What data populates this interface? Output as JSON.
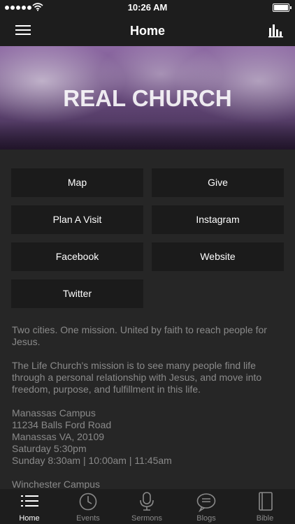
{
  "status_bar": {
    "time": "10:26 AM"
  },
  "nav": {
    "title": "Home"
  },
  "hero": {
    "title": "REAL CHURCH"
  },
  "buttons": [
    {
      "label": "Map"
    },
    {
      "label": "Give"
    },
    {
      "label": "Plan A Visit"
    },
    {
      "label": "Instagram"
    },
    {
      "label": "Facebook"
    },
    {
      "label": "Website"
    },
    {
      "label": "Twitter"
    }
  ],
  "content": {
    "tagline": "Two cities. One mission. United by faith to reach people for Jesus.",
    "mission": "The Life Church's mission is to see many people find life through a personal relationship with Jesus, and move into freedom, purpose, and fulfillment in this life.",
    "campus1": {
      "name": "Manassas Campus",
      "street": "11234 Balls Ford Road",
      "city": "Manassas VA, 20109",
      "saturday": "Saturday 5:30pm",
      "sunday": "Sunday 8:30am | 10:00am | 11:45am"
    },
    "campus2": {
      "name": "Winchester Campus"
    }
  },
  "tabs": [
    {
      "label": "Home",
      "icon": "list-icon",
      "active": true
    },
    {
      "label": "Events",
      "icon": "clock-icon",
      "active": false
    },
    {
      "label": "Sermons",
      "icon": "microphone-icon",
      "active": false
    },
    {
      "label": "Blogs",
      "icon": "chat-bubble-icon",
      "active": false
    },
    {
      "label": "Bible",
      "icon": "book-icon",
      "active": false
    }
  ],
  "colors": {
    "background": "#262626",
    "bar": "#1d1d1d",
    "button": "#1b1b1b",
    "muted_text": "#8a8a8a"
  }
}
